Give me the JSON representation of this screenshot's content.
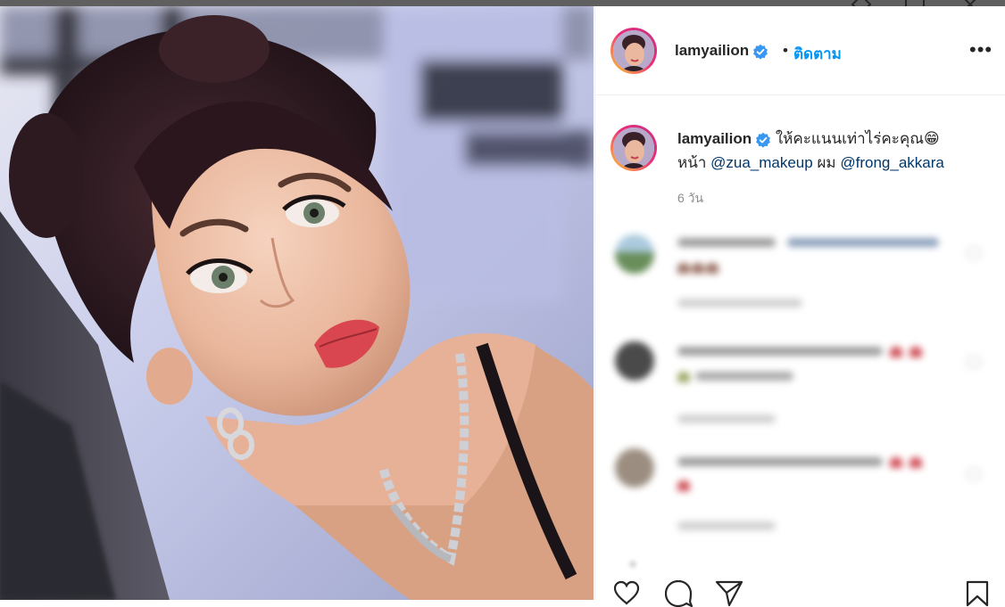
{
  "post": {
    "username": "lamyailion",
    "dot": "•",
    "follow_label": "ติดตาม",
    "more_label": "•••",
    "caption": {
      "username": "lamyailion",
      "line1_text": "ให้คะแนนเท่าไร่คะคุณ😁",
      "line2_prefix": "หน้า",
      "mention1": "@zua_makeup",
      "middle": "ผม",
      "mention2": "@frong_akkara"
    },
    "time": "6 วัน"
  },
  "icons": {
    "verified": "verified-badge-icon",
    "like": "heart-icon",
    "comment": "comment-icon",
    "share": "paper-plane-icon",
    "save": "bookmark-icon"
  },
  "colors": {
    "accent": "#0095f6",
    "mention": "#00376b",
    "verified": "#3897f0",
    "meta": "#8e8e8e"
  }
}
